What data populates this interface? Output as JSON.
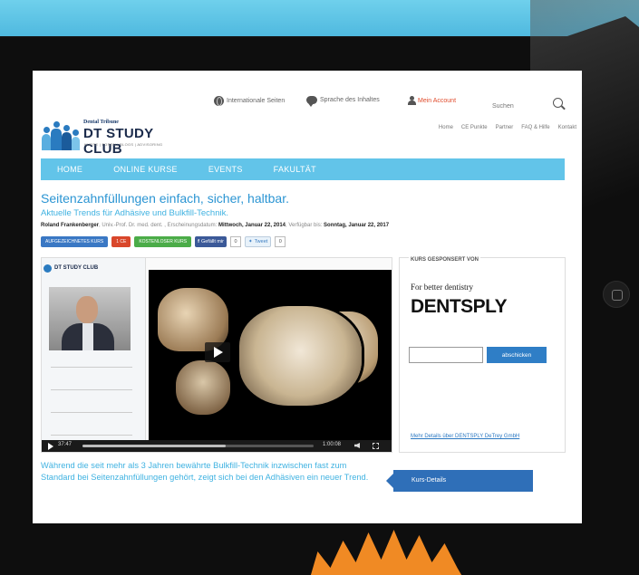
{
  "header": {
    "top_links": [
      {
        "label": "Internationale Seiten",
        "icon": "globe-icon"
      },
      {
        "label": "Sprache des Inhaltes",
        "icon": "speech-bubble-icon"
      },
      {
        "label": "Mein Account",
        "icon": "user-icon"
      }
    ],
    "search_placeholder": "Suchen",
    "right_nav": [
      "Home",
      "CE Punkte",
      "Partner",
      "FAQ & Hilfe",
      "Kontakt"
    ]
  },
  "logo": {
    "tribune": "Dental Tribune",
    "title": "DT STUDY CLUB",
    "tagline": "KURSE | FOREN | BLOGS | ADVISORING"
  },
  "main_nav": [
    "HOME",
    "ONLINE KURSE",
    "EVENTS",
    "FAKULTÄT"
  ],
  "course": {
    "title": "Seitenzahnfüllungen einfach, sicher, haltbar.",
    "subtitle": "Aktuelle Trends für Adhäsive und Bulkfill-Technik.",
    "author": "Roland Frankenberger",
    "author_title": ", Univ.-Prof. Dr. med. dent. , Erscheinungsdatum: ",
    "date_label": "Mittwoch, Januar 22, 2014",
    "available_label": ", Verfügbar bis: ",
    "available_date": "Sonntag, Januar 22, 2017",
    "badges": [
      "AUFGEZEICHNETES KURS",
      "1 CE",
      "KOSTENLOSER KURS"
    ],
    "facebook_label": "Gefällt mir",
    "facebook_count": "0",
    "twitter_label": "Tweet",
    "twitter_count": "0"
  },
  "player": {
    "mini_logo": "DT STUDY CLUB",
    "elapsed": "37:47",
    "duration": "1:00:08",
    "progress_fraction": 0.62
  },
  "sponsor": {
    "heading": "KURS GESPONSERT VON",
    "tagline": "For better dentistry",
    "brand": "DENTSPLY",
    "button_label": "abschicken",
    "link": "Mehr Details über DENTSPLY DeTrey GmbH"
  },
  "intro_text": "Während die seit mehr als 3 Jahren bewährte Bulkfill-Technik inzwischen fast zum Standard bei Seitenzahnfüllungen gehört, zeigt sich bei den Adhäsiven ein neuer Trend.",
  "kurs_details": "Kurs-Details",
  "colors": {
    "accent": "#62c4e9",
    "title_blue": "#2b95d3",
    "account_red": "#e04d2e",
    "button_blue": "#2f7ec6"
  }
}
